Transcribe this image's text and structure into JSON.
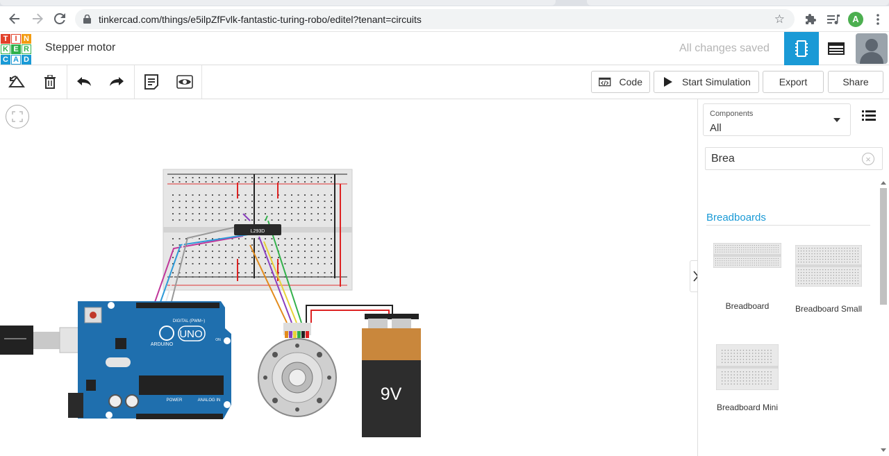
{
  "browser": {
    "url": "tinkercad.com/things/e5ilpZfFvlk-fantastic-turing-robo/editel?tenant=circuits",
    "profile_initial": "A"
  },
  "header": {
    "logo_letters": [
      "T",
      "I",
      "N",
      "K",
      "E",
      "R",
      "C",
      "A",
      "D"
    ],
    "project_title": "Stepper motor",
    "save_status": "All changes saved"
  },
  "toolbar": {
    "code_label": "Code",
    "start_simulation_label": "Start Simulation",
    "export_label": "Export",
    "share_label": "Share"
  },
  "circuit": {
    "driver_chip_label": "L293D",
    "board_digital_label": "DIGITAL (PWM~)",
    "board_brand": "ARDUINO",
    "board_model": "UNO",
    "board_on_label": "ON",
    "board_power_label": "POWER",
    "board_analog_label": "ANALOG IN",
    "battery_label": "9V"
  },
  "panel": {
    "components_label": "Components",
    "components_value": "All",
    "search_value": "Brea",
    "section_title": "Breadboards",
    "items": [
      {
        "label": "Breadboard"
      },
      {
        "label": "Breadboard Small"
      },
      {
        "label": "Breadboard Mini"
      }
    ]
  },
  "colors": {
    "accent": "#1a9ad6",
    "arduino_blue": "#1f6fae",
    "battery_orange": "#c9873c",
    "battery_black": "#2d2d2d",
    "logo_red": "#e2412a",
    "logo_orange": "#f39c12",
    "logo_green": "#2eb04a",
    "logo_blue": "#1a9ad6"
  }
}
